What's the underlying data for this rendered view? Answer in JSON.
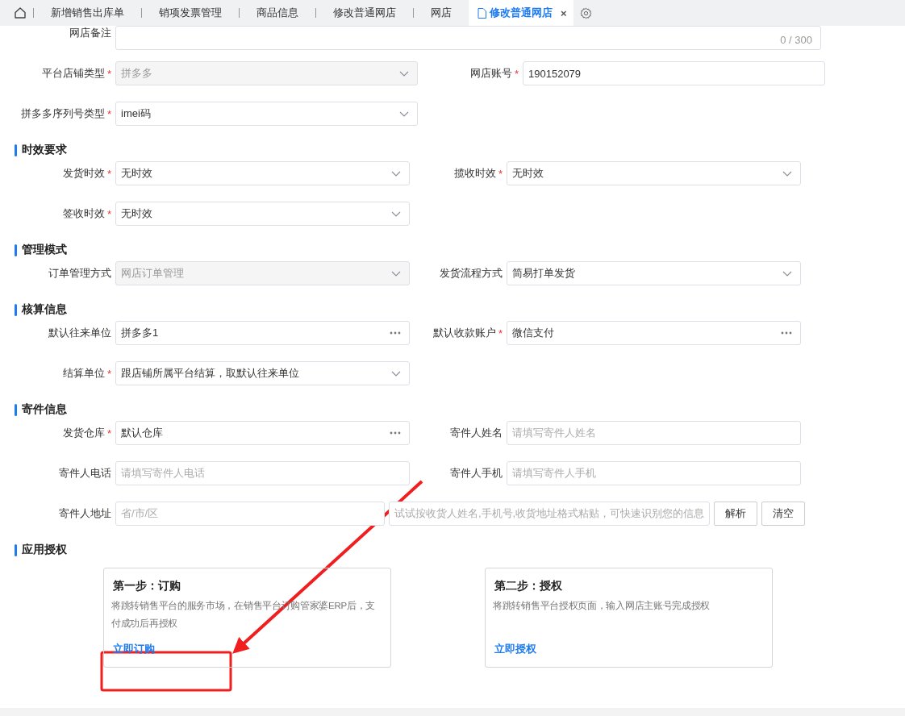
{
  "tabs": [
    {
      "label": "新增销售出库单",
      "selected": false
    },
    {
      "label": "销项发票管理",
      "selected": false
    },
    {
      "label": "商品信息",
      "selected": false
    },
    {
      "label": "修改普通网店",
      "selected": false
    },
    {
      "label": "网店",
      "selected": false
    },
    {
      "label": "修改普通网店",
      "selected": true,
      "close": "×"
    }
  ],
  "sections": [
    {
      "rows": [
        [
          {
            "kind": "textarea",
            "label": "网店备注",
            "counter": "0 / 300"
          }
        ],
        [
          {
            "kind": "select",
            "label": "平台店铺类型",
            "required_mark": "*",
            "value": "拼多多",
            "disabled": true
          },
          {
            "kind": "text",
            "label": "网店账号",
            "required_mark": "*",
            "value": "190152079"
          }
        ],
        [
          {
            "kind": "select",
            "label": "拼多多序列号类型",
            "required_mark": "*",
            "value": "imei码",
            "disabled": false
          }
        ]
      ]
    },
    {
      "title": "时效要求",
      "rows": [
        [
          {
            "kind": "select",
            "label": "发货时效",
            "required_mark": "*",
            "value": "无时效",
            "disabled": false
          },
          {
            "kind": "select",
            "label": "揽收时效",
            "required_mark": "*",
            "value": "无时效",
            "disabled": false
          }
        ],
        [
          {
            "kind": "select",
            "label": "签收时效",
            "required_mark": "*",
            "value": "无时效",
            "disabled": false
          }
        ]
      ]
    },
    {
      "title": "管理模式",
      "rows": [
        [
          {
            "kind": "select",
            "label": "订单管理方式",
            "value": "网店订单管理",
            "disabled": true
          },
          {
            "kind": "select",
            "label": "发货流程方式",
            "value": "简易打单发货",
            "disabled": false
          }
        ]
      ]
    },
    {
      "title": "核算信息",
      "rows": [
        [
          {
            "kind": "lookup",
            "label": "默认往来单位",
            "value": "拼多多1"
          },
          {
            "kind": "lookup",
            "label": "默认收款账户",
            "required_mark": "*",
            "value": "微信支付"
          }
        ],
        [
          {
            "kind": "select",
            "label": "结算单位",
            "required_mark": "*",
            "value": "跟店铺所属平台结算，取默认往来单位",
            "disabled": false
          }
        ]
      ]
    },
    {
      "title": "寄件信息",
      "rows": [
        [
          {
            "kind": "lookup",
            "label": "发货仓库",
            "required_mark": "*",
            "value": "默认仓库"
          },
          {
            "kind": "text",
            "label": "寄件人姓名",
            "placeholder": "请填写寄件人姓名"
          }
        ],
        [
          {
            "kind": "text",
            "label": "寄件人电话",
            "placeholder": "请填写寄件人电话"
          },
          {
            "kind": "text",
            "label": "寄件人手机",
            "placeholder": "请填写寄件人手机"
          }
        ],
        [
          {
            "kind": "text",
            "label": "寄件人地址",
            "placeholder": "省/市/区"
          },
          {
            "kind": "text",
            "placeholder": "试试按收货人姓名,手机号,收货地址格式粘贴，可快速识别您的信息"
          },
          {
            "kind": "button",
            "label": "解析"
          },
          {
            "kind": "button",
            "label": "清空"
          }
        ]
      ]
    },
    {
      "title": "应用授权"
    }
  ],
  "cards": [
    {
      "title": "第一步：订购",
      "description": "将跳转销售平台的服务市场，在销售平台订购管家婆ERP后，支付成功后再授权",
      "link": "立即订购"
    },
    {
      "title": "第二步：授权",
      "description": "将跳转销售平台授权页面，输入网店主账号完成授权",
      "link": "立即授权"
    }
  ]
}
